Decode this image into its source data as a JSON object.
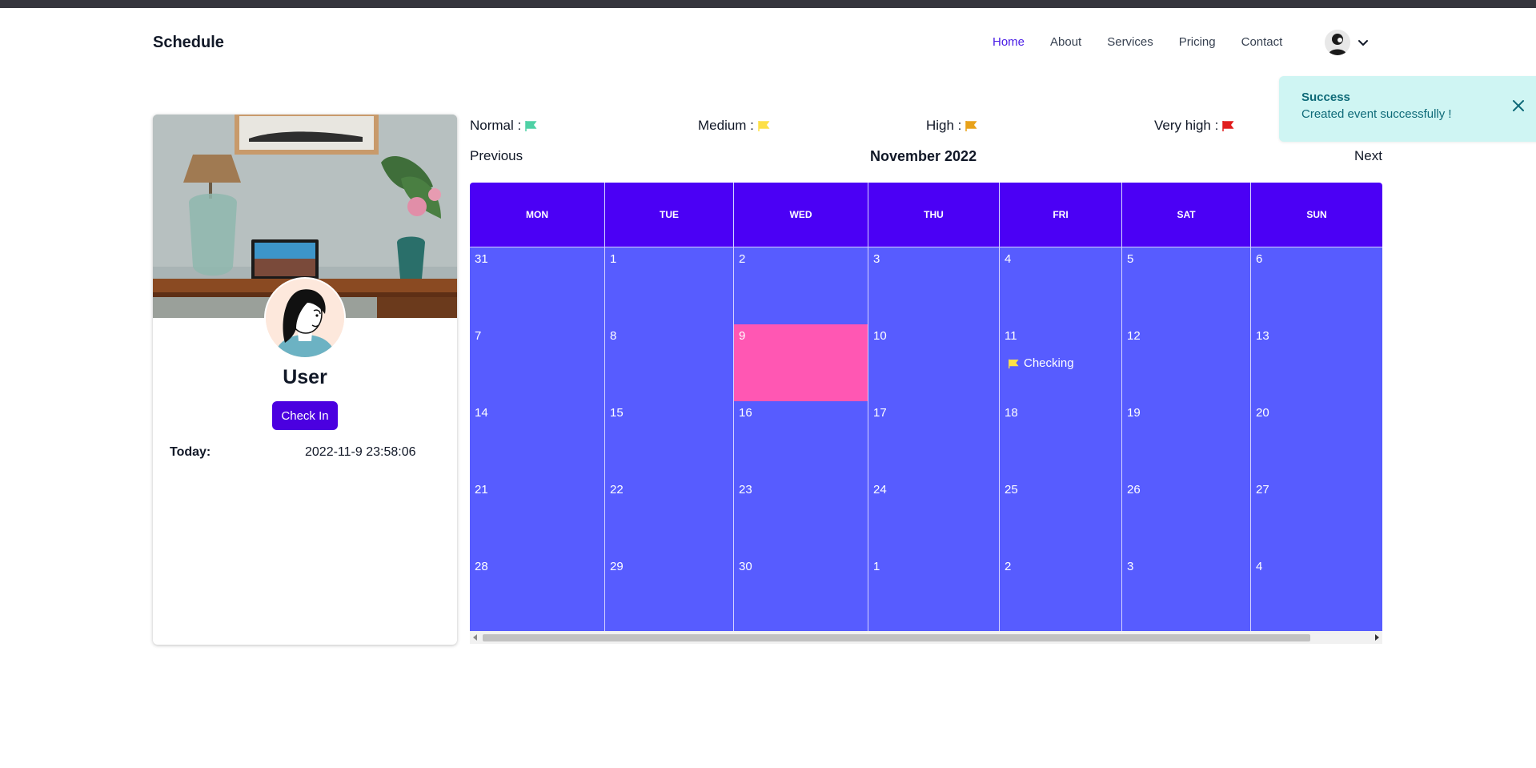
{
  "app": {
    "brand": "Schedule"
  },
  "nav": {
    "links": [
      "Home",
      "About",
      "Services",
      "Pricing",
      "Contact"
    ],
    "active": "Home"
  },
  "toast": {
    "title": "Success",
    "message": "Created event successfully !"
  },
  "profile": {
    "name": "User",
    "checkin_label": "Check In",
    "today_label": "Today:",
    "today_value": "2022-11-9 23:58:06"
  },
  "legend": [
    {
      "label": "Normal :",
      "color": "#4fd1a5"
    },
    {
      "label": "Medium :",
      "color": "#fde047"
    },
    {
      "label": "High :",
      "color": "#e8a21a"
    },
    {
      "label": "Very high :",
      "color": "#e11d1d"
    }
  ],
  "calendar": {
    "previous_label": "Previous",
    "next_label": "Next",
    "month_title": "November 2022",
    "weekdays": [
      "MON",
      "TUE",
      "WED",
      "THU",
      "FRI",
      "SAT",
      "SUN"
    ],
    "weeks": [
      [
        "31",
        "1",
        "2",
        "3",
        "4",
        "5",
        "6"
      ],
      [
        "7",
        "8",
        "9",
        "10",
        "11",
        "12",
        "13"
      ],
      [
        "14",
        "15",
        "16",
        "17",
        "18",
        "19",
        "20"
      ],
      [
        "21",
        "22",
        "23",
        "24",
        "25",
        "26",
        "27"
      ],
      [
        "28",
        "29",
        "30",
        "1",
        "2",
        "3",
        "4"
      ]
    ],
    "today_cell": {
      "week": 1,
      "day": 2
    },
    "events": [
      {
        "week": 1,
        "day": 4,
        "title": "Checking",
        "priority_color": "#fde047"
      }
    ],
    "colors": {
      "header": "#4b00f5",
      "cell": "#575cff",
      "today": "#ff57b3"
    }
  }
}
